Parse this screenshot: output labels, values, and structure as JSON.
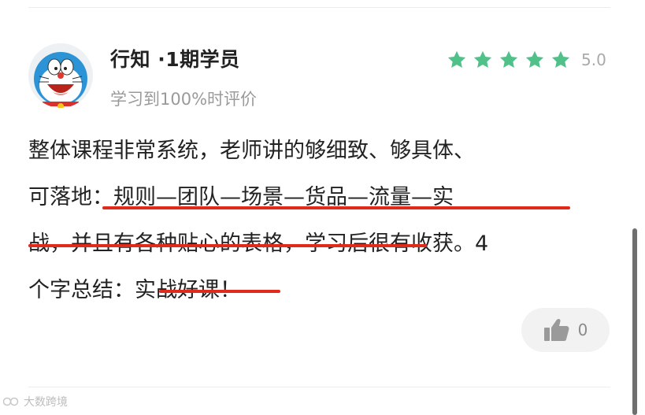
{
  "review": {
    "user_name": "行知 ·1期学员",
    "progress_note": "学习到100%时评价",
    "rating": {
      "stars": 5,
      "score": "5.0",
      "star_color": "#4fc189"
    },
    "text_lines": [
      "整体课程非常系统，老师讲的够细致、够具体、",
      "可落地：规则—团队—场景—货品—流量—实",
      "战，并且有各种贴心的表格，学习后很有收获。4",
      "个字总结：实战好课！"
    ],
    "likes": {
      "count": "0"
    }
  },
  "annotation_color": "#e02a1c",
  "watermark": {
    "text": "大数跨境"
  }
}
